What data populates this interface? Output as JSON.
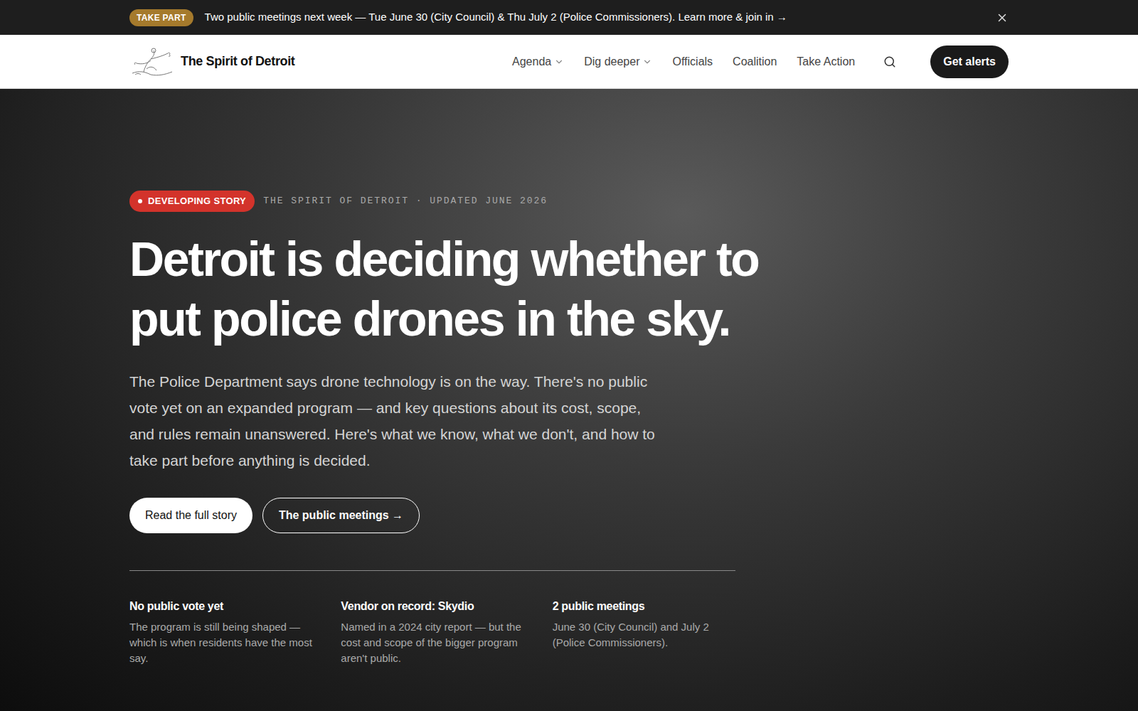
{
  "announcement": {
    "badge": "TAKE PART",
    "text": "Two public meetings next week — Tue June 30 (City Council) & Thu July 2 (Police Commissioners). Learn more & join in →"
  },
  "nav": {
    "brand": "The Spirit of Detroit",
    "links": [
      {
        "label": "Agenda",
        "dropdown": true
      },
      {
        "label": "Dig deeper",
        "dropdown": true
      },
      {
        "label": "Officials",
        "dropdown": false
      },
      {
        "label": "Coalition",
        "dropdown": false
      },
      {
        "label": "Take Action",
        "dropdown": false
      }
    ],
    "cta": "Get alerts"
  },
  "hero": {
    "badge": "DEVELOPING STORY",
    "meta": "THE SPIRIT OF DETROIT · UPDATED JUNE 2026",
    "title_lines": [
      "Detroit is deciding whether to",
      "put police drones in the sky."
    ],
    "lead": "The Police Department says drone technology is on the way. There's no public vote yet on an expanded program — and key questions about its cost, scope, and rules remain unanswered. Here's what we know, what we don't, and how to take part before anything is decided.",
    "buttons": [
      {
        "label": "Read the full story",
        "kind": "primary"
      },
      {
        "label": "The public meetings →",
        "kind": "outline"
      }
    ],
    "facts": [
      {
        "title": "No public vote yet",
        "text": "The program is still being shaped — which is when residents have the most say."
      },
      {
        "title": "Vendor on record: Skydio",
        "text": "Named in a 2024 city report — but the cost and scope of the bigger program aren't public."
      },
      {
        "title": "2 public meetings",
        "text": "June 30 (City Council) and July 2 (Police Commissioners)."
      }
    ]
  }
}
